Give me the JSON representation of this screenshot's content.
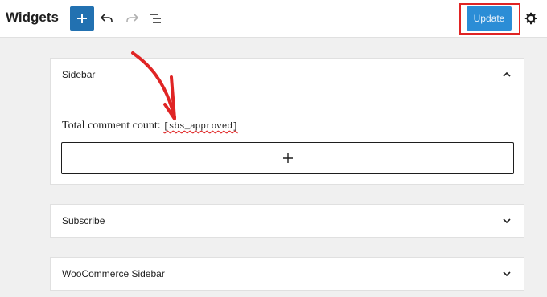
{
  "header": {
    "title": "Widgets",
    "update_label": "Update"
  },
  "panels": [
    {
      "label": "Sidebar",
      "expanded": true,
      "content": {
        "text": "Total comment count:",
        "shortcode": "[sbs_approved]"
      }
    },
    {
      "label": "Subscribe",
      "expanded": false
    },
    {
      "label": "WooCommerce Sidebar",
      "expanded": false
    }
  ],
  "colors": {
    "accent": "#2271b1",
    "highlight": "#e02424"
  },
  "icons": [
    "plus-icon",
    "undo-icon",
    "redo-icon",
    "list-view-icon",
    "gear-icon",
    "chevron-up-icon",
    "chevron-down-icon",
    "arrow-annotation"
  ]
}
